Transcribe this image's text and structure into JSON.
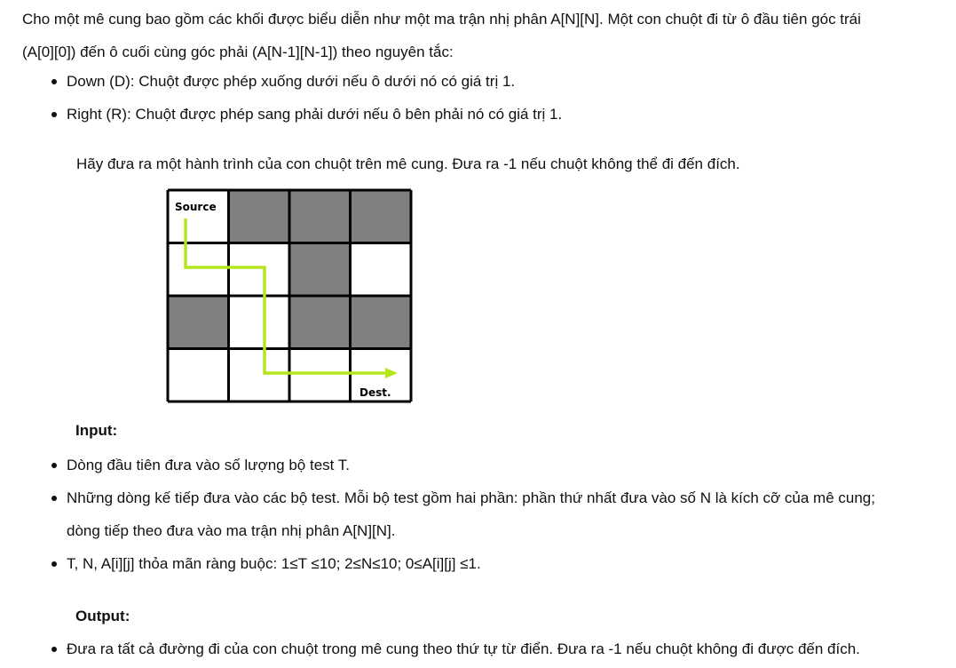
{
  "intro": {
    "line1": "Cho một mê cung bao gồm các khối được biểu diễn như một ma trận nhị phân A[N][N]. Một con chuột đi từ ô đầu tiên góc trái",
    "line2": "(A[0][0]) đến ô cuối cùng góc phải (A[N-1][N-1]) theo nguyên tắc:"
  },
  "rules": [
    "Down (D): Chuột được phép xuống dưới nếu ô dưới nó có giá trị 1.",
    "Right (R): Chuột được phép sang phải dưới nếu ô bên phải nó có giá trị 1."
  ],
  "task": "Hãy đưa ra một hành trình của con chuột trên mê cung. Đưa ra -1 nếu chuột không thể đi đến đích.",
  "maze": {
    "matrix": [
      [
        1,
        0,
        0,
        0
      ],
      [
        1,
        1,
        0,
        1
      ],
      [
        0,
        1,
        0,
        0
      ],
      [
        1,
        1,
        1,
        1
      ]
    ],
    "source_label": "Source",
    "dest_label": "Dest.",
    "colors": {
      "open": "#ffffff",
      "blocked": "#808080",
      "border": "#000000",
      "path": "#b5e61d"
    }
  },
  "input": {
    "heading": "Input:",
    "items": [
      "Dòng đầu tiên đưa vào số lượng bộ test T.",
      "Những dòng kế tiếp đưa vào các bộ test. Mỗi bộ test gồm hai phần: phần thứ nhất đưa vào số N là kích cỡ của mê cung;",
      "dòng tiếp theo đưa vào ma trận nhị phân A[N][N].",
      "T, N, A[i][j] thỏa mãn ràng buộc: 1≤T ≤10; 2≤N≤10; 0≤A[i][j] ≤1."
    ]
  },
  "output": {
    "heading": "Output:",
    "items": [
      "Đưa ra tất cả đường đi của con chuột trong mê cung theo thứ tự từ điển. Đưa ra -1 nếu chuột không đi được đến đích."
    ]
  }
}
